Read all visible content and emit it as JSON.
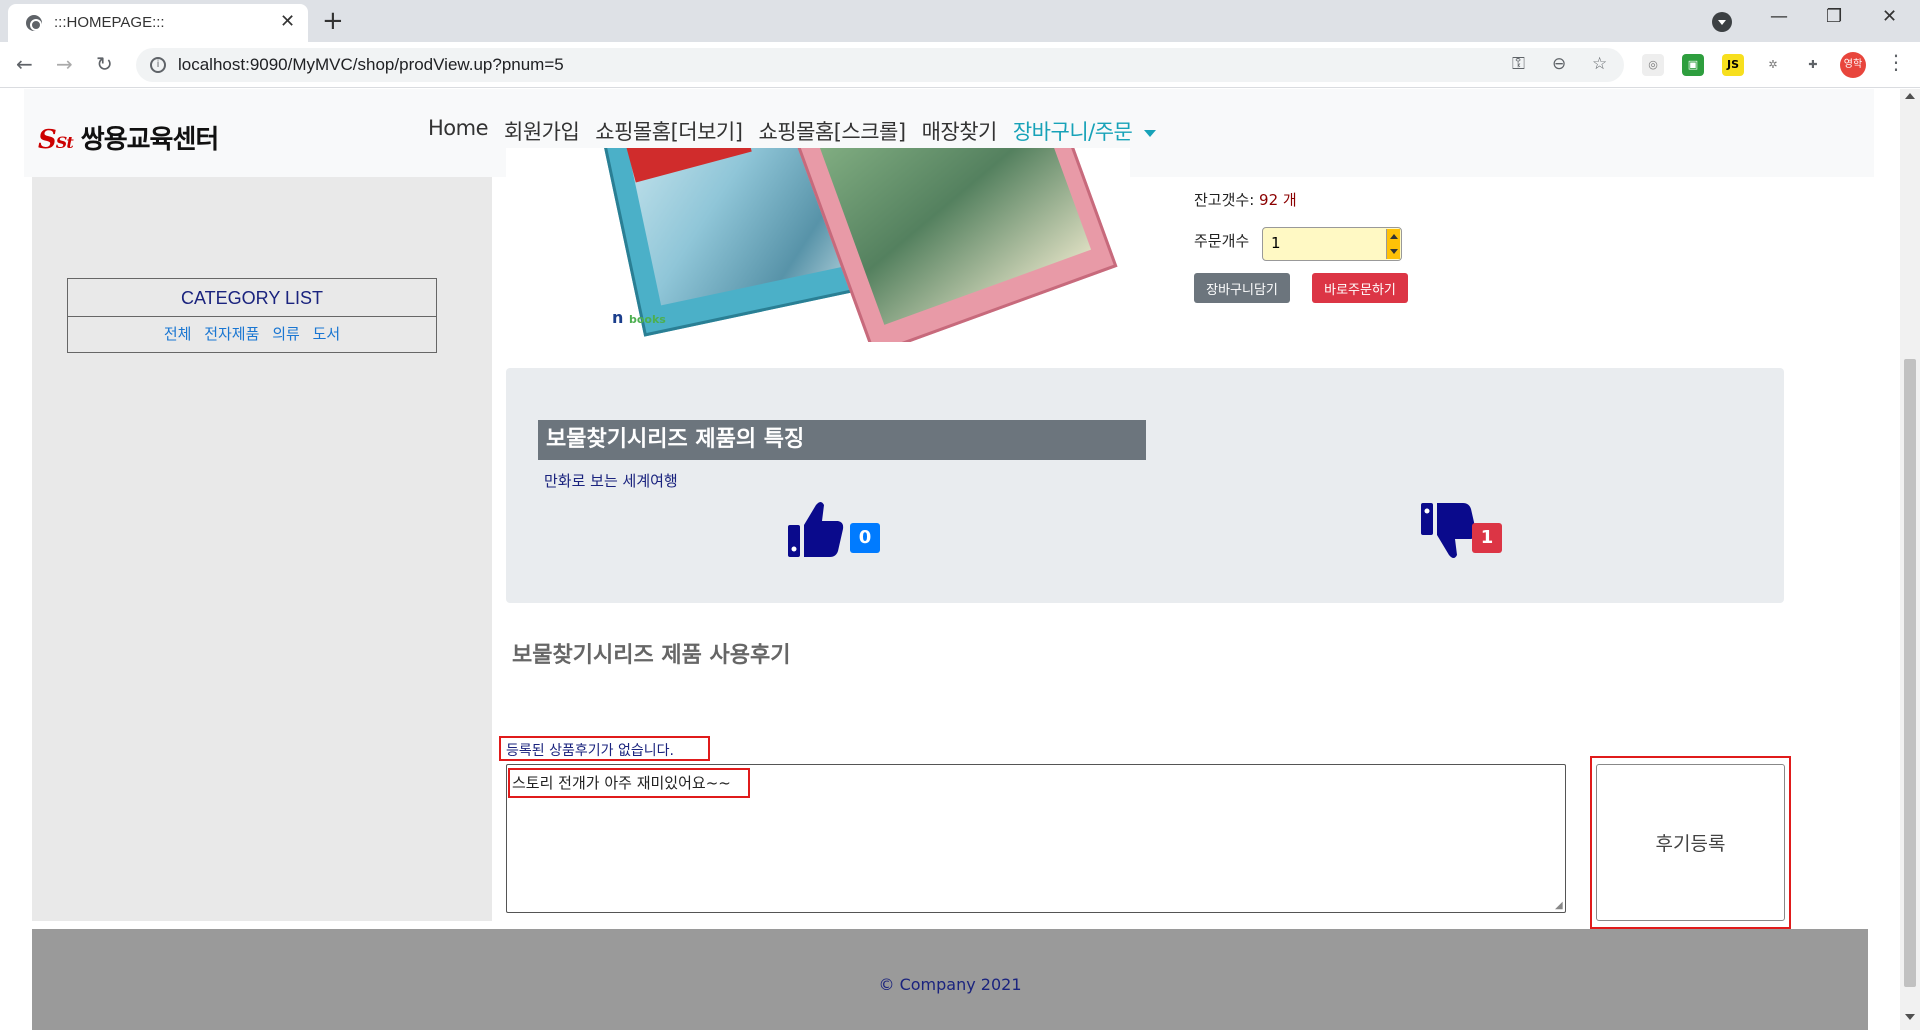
{
  "browser": {
    "tab_title": ":::HOMEPAGE:::",
    "url": "localhost:9090/MyMVC/shop/prodView.up?pnum=5",
    "profile_label": "영학",
    "ext_js": "JS"
  },
  "header": {
    "logo_text": "쌍용교육센터",
    "nav": [
      "Home",
      "회원가입",
      "쇼핑몰홈[더보기]",
      "쇼핑몰홈[스크롤]",
      "매장찾기",
      "장바구니/주문"
    ]
  },
  "sidebar": {
    "category_title": "CATEGORY LIST",
    "categories": [
      "전체",
      "전자제품",
      "의류",
      "도서"
    ]
  },
  "product": {
    "stock_label": "잔고갯수:",
    "stock_value": "92 개",
    "qty_label": "주문개수",
    "qty_value": "1",
    "add_cart_label": "장바구니담기",
    "buy_now_label": "바로주문하기",
    "image_brand": "books"
  },
  "features": {
    "title": "보물찾기시리즈 제품의 특징",
    "description": "만화로 보는 세계여행",
    "like_count": "0",
    "dislike_count": "1"
  },
  "review": {
    "title": "보물찾기시리즈 제품 사용후기",
    "empty_message": "등록된 상품후기가 없습니다.",
    "textarea_value": "스토리 전개가 아주 재미있어요~~",
    "submit_label": "후기등록"
  },
  "footer": {
    "copyright": "© Company 2021"
  },
  "colors": {
    "accent_teal": "#17a2b8",
    "like_blue": "#007bff",
    "dislike_red": "#dc3545",
    "thumb_navy": "#0a0a8c",
    "highlight_red": "#e01b1b"
  },
  "icons": [
    "globe-icon",
    "close-icon",
    "plus-icon",
    "back-icon",
    "forward-icon",
    "reload-icon",
    "info-icon",
    "key-icon",
    "zoom-icon",
    "star-icon",
    "puzzle-icon",
    "thumbs-up-icon",
    "thumbs-down-icon"
  ]
}
